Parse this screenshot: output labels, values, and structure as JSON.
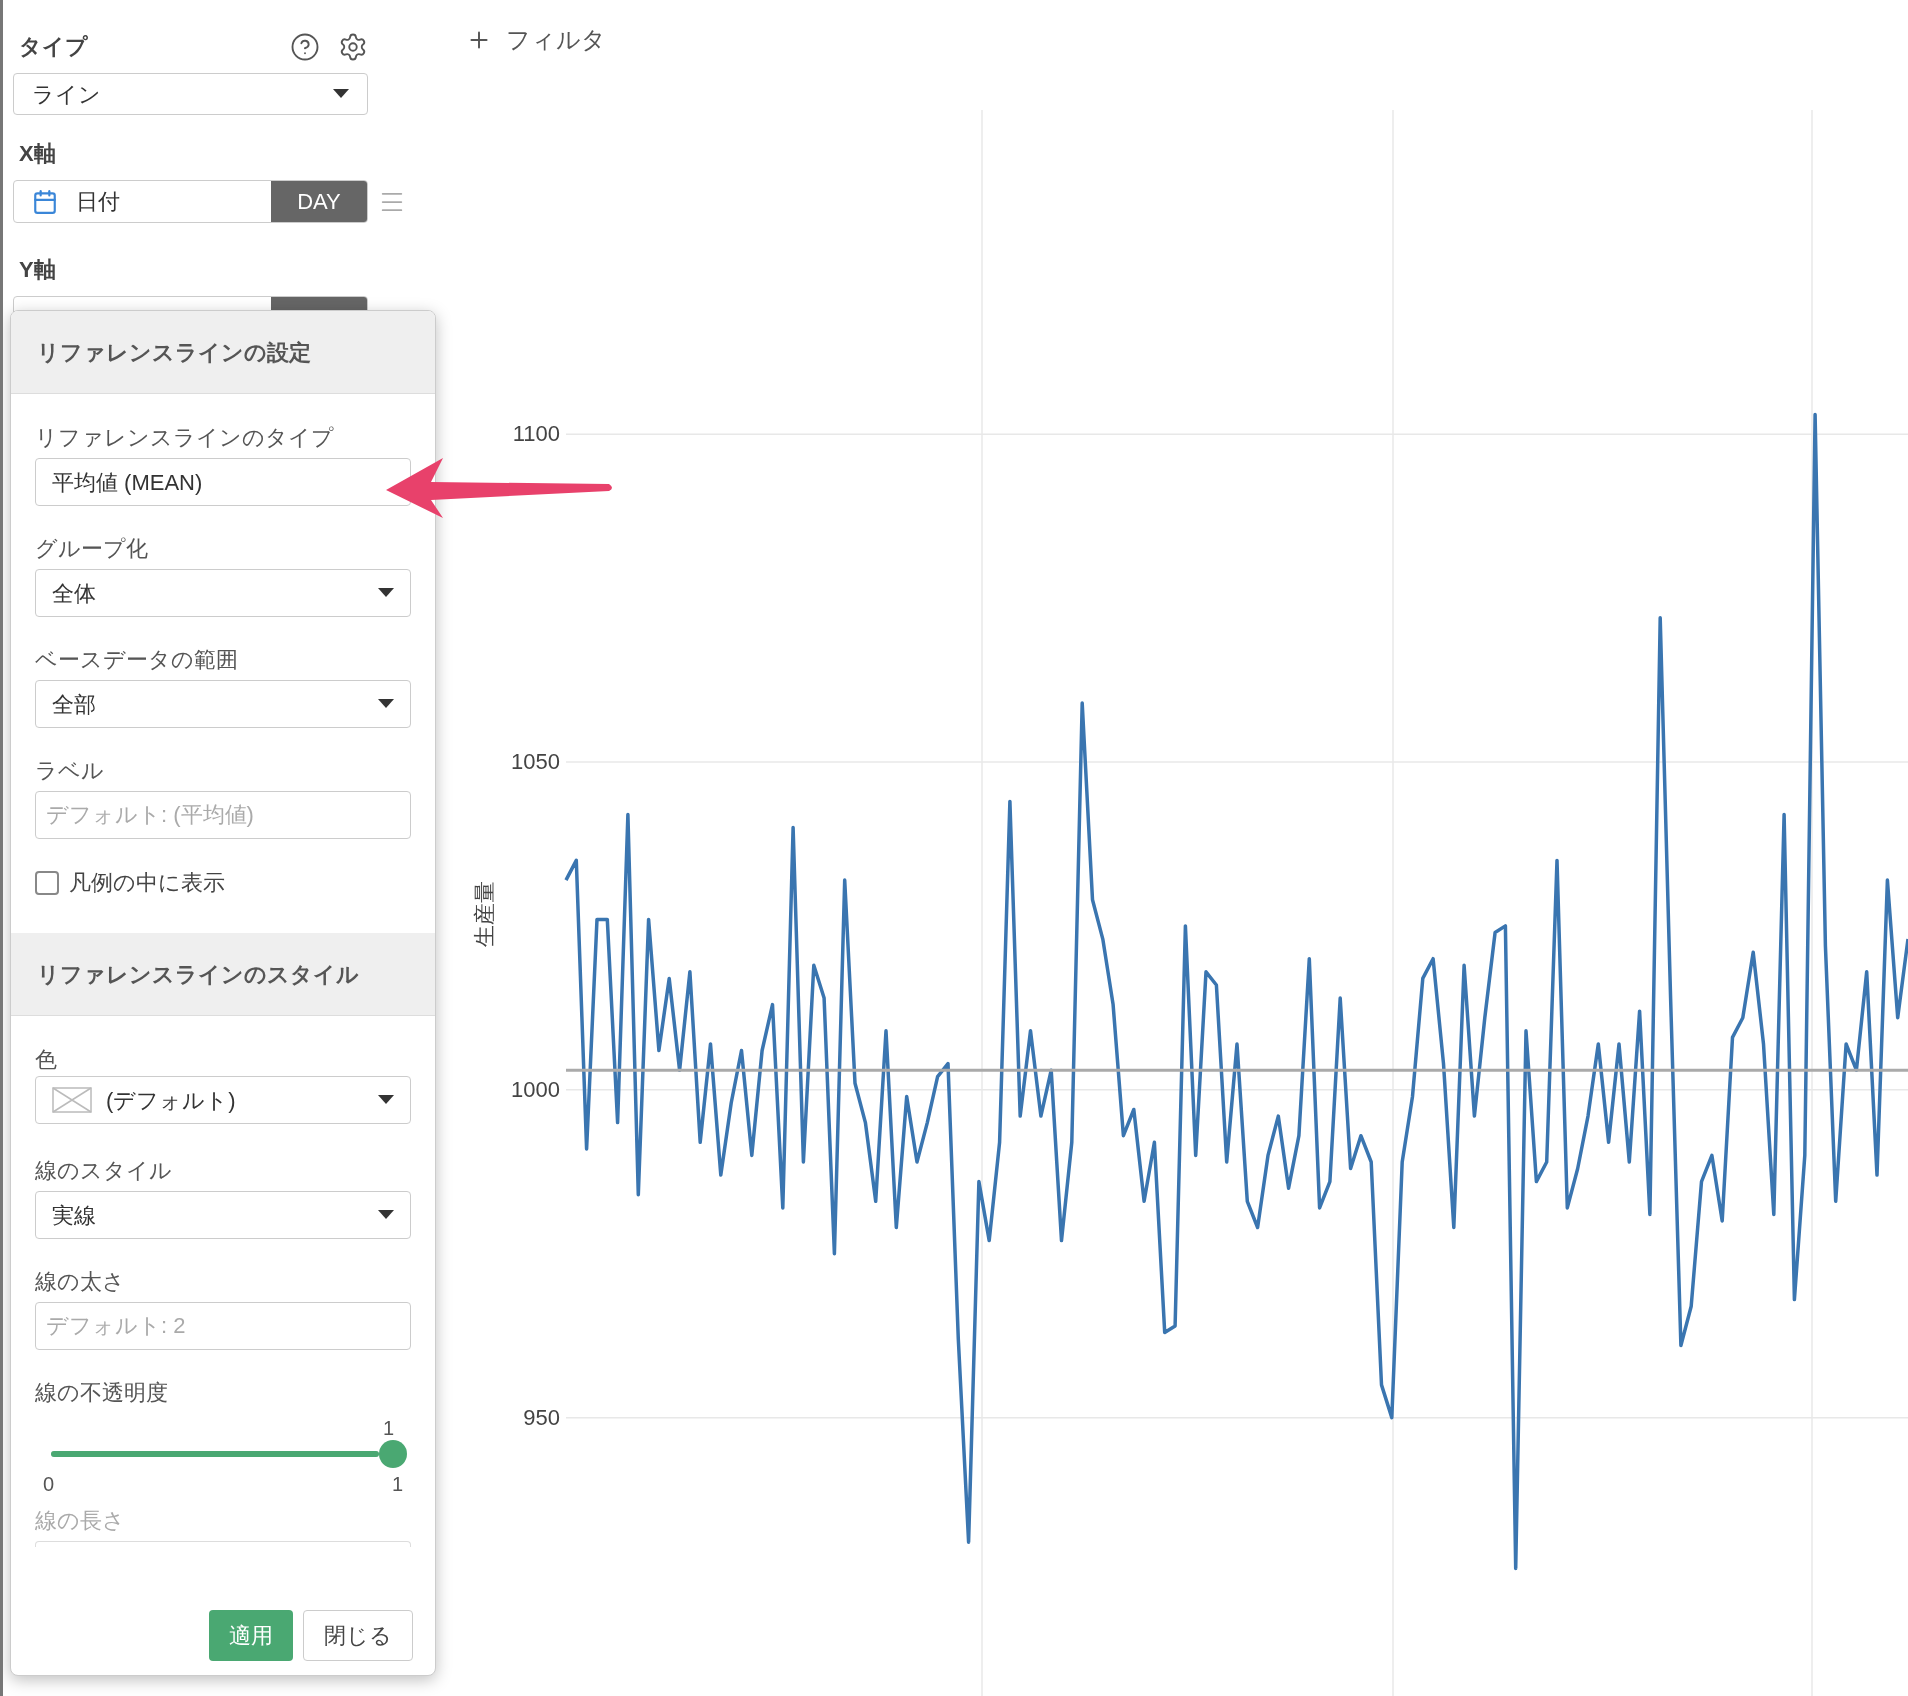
{
  "type_section": {
    "label": "タイプ",
    "select": "ライン"
  },
  "x_axis": {
    "label": "X軸",
    "field": "日付",
    "unit": "DAY"
  },
  "y_axis": {
    "label": "Y軸"
  },
  "filter_button": "フィルタ",
  "popup": {
    "sections": [
      {
        "title": "リファレンスラインの設定",
        "fields": [
          {
            "kind": "input",
            "label": "リファレンスラインのタイプ",
            "value": "平均値 (MEAN)"
          },
          {
            "kind": "select",
            "label": "グループ化",
            "value": "全体"
          },
          {
            "kind": "select",
            "label": "ベースデータの範囲",
            "value": "全部"
          },
          {
            "kind": "input",
            "label": "ラベル",
            "placeholder": "デフォルト: (平均値)"
          },
          {
            "kind": "checkbox",
            "label": "凡例の中に表示",
            "checked": false
          }
        ]
      },
      {
        "title": "リファレンスラインのスタイル",
        "fields": [
          {
            "kind": "color_select",
            "label": "色",
            "value": "(デフォルト)"
          },
          {
            "kind": "select",
            "label": "線のスタイル",
            "value": "実線"
          },
          {
            "kind": "input",
            "label": "線の太さ",
            "placeholder": "デフォルト: 2"
          },
          {
            "kind": "slider",
            "label": "線の不透明度",
            "reading": "1",
            "min": "0",
            "max": "1",
            "level": 1
          },
          {
            "kind": "cut_field",
            "label": "線の長さ",
            "disabled": true
          }
        ]
      }
    ],
    "buttons": [
      {
        "label": "適用",
        "primary": true
      },
      {
        "label": "閉じる",
        "primary": false
      }
    ]
  },
  "chart": {
    "chart_data": {
      "type": "line",
      "ylabel": "生産量",
      "ylim": [
        908,
        1149
      ],
      "yticks": [
        950,
        1000,
        1050,
        1100
      ],
      "series": [
        {
          "color": "#3a75b0",
          "values": [
            1032,
            1035,
            991,
            1026,
            1026,
            995,
            1042,
            984,
            1026,
            1006,
            1017,
            1003,
            1018,
            992,
            1007,
            987,
            998,
            1006,
            990,
            1006,
            1013,
            982,
            1040,
            989,
            1019,
            1014,
            975,
            1032,
            1001,
            995,
            983,
            1009,
            979,
            999,
            989,
            995,
            1002,
            1004,
            962,
            931,
            986,
            977,
            992,
            1044,
            996,
            1009,
            996,
            1003,
            977,
            992,
            1059,
            1029,
            1023,
            1013,
            993,
            997,
            983,
            992,
            963,
            964,
            1025,
            990,
            1018,
            1016,
            989,
            1007,
            983,
            979,
            990,
            996,
            985,
            993,
            1020,
            982,
            986,
            1014,
            988,
            993,
            989,
            955,
            950,
            989,
            999,
            1017,
            1020,
            1004,
            979,
            1019,
            996,
            1011,
            1024,
            1025,
            927,
            1009,
            986,
            989,
            1035,
            982,
            988,
            996,
            1007,
            992,
            1007,
            989,
            1012,
            981,
            1072,
            1014,
            961,
            967,
            986,
            990,
            980,
            1008,
            1011,
            1021,
            1007,
            981,
            1042,
            968,
            990,
            1103,
            1022,
            983,
            1007,
            1003,
            1018,
            987,
            1032,
            1011,
            1023
          ]
        },
        {
          "color": "#aaaaaa",
          "values": [
            1003,
            1003,
            1003,
            1003,
            1003,
            1003,
            1003,
            1003,
            1003,
            1003,
            1003,
            1003,
            1003,
            1003,
            1003,
            1003,
            1003,
            1003,
            1003,
            1003,
            1003,
            1003,
            1003,
            1003,
            1003,
            1003,
            1003,
            1003,
            1003,
            1003,
            1003,
            1003,
            1003,
            1003,
            1003,
            1003,
            1003,
            1003,
            1003,
            1003,
            1003,
            1003,
            1003,
            1003,
            1003,
            1003,
            1003,
            1003,
            1003,
            1003,
            1003,
            1003,
            1003,
            1003,
            1003,
            1003,
            1003,
            1003,
            1003,
            1003,
            1003,
            1003,
            1003,
            1003,
            1003,
            1003,
            1003,
            1003,
            1003,
            1003,
            1003,
            1003,
            1003,
            1003,
            1003,
            1003,
            1003,
            1003,
            1003,
            1003,
            1003,
            1003,
            1003,
            1003,
            1003,
            1003,
            1003,
            1003,
            1003,
            1003,
            1003,
            1003,
            1003,
            1003,
            1003,
            1003,
            1003,
            1003,
            1003,
            1003,
            1003,
            1003,
            1003,
            1003,
            1003,
            1003,
            1003,
            1003,
            1003,
            1003,
            1003,
            1003,
            1003,
            1003,
            1003,
            1003,
            1003,
            1003,
            1003,
            1003,
            1003,
            1003,
            1003,
            1003,
            1003,
            1003,
            1003,
            1003,
            1003,
            1003,
            1003
          ]
        }
      ],
      "grid": true
    }
  }
}
